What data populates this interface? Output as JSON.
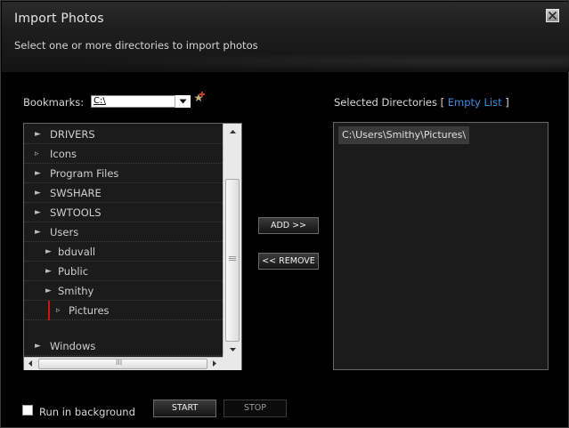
{
  "window": {
    "title": "Import Photos",
    "subtitle": "Select one or more directories to import photos",
    "close_icon": "close-x-icon"
  },
  "bookmarks": {
    "label": "Bookmarks:",
    "selected_value": "C:\\",
    "dropdown_icon": "chevron-down-icon",
    "add_icon": "add-bookmark-star-icon"
  },
  "tree": {
    "items": [
      {
        "label": "DRIVERS",
        "expanded": false
      },
      {
        "label": "Icons",
        "expanded": false,
        "leaf": true
      },
      {
        "label": "Program Files",
        "expanded": false
      },
      {
        "label": "SWSHARE",
        "expanded": false
      },
      {
        "label": "SWTOOLS",
        "expanded": false
      },
      {
        "label": "Users",
        "expanded": true
      },
      {
        "label": "bduvall",
        "expanded": false
      },
      {
        "label": "Public",
        "expanded": false
      },
      {
        "label": "Smithy",
        "expanded": true
      },
      {
        "label": "Pictures",
        "expanded": false,
        "leaf": true,
        "selected": true
      },
      {
        "label": "Windows",
        "expanded": false
      }
    ],
    "hscroll_grip": "III"
  },
  "actions": {
    "add_label": "ADD >>",
    "remove_label": "<< REMOVE"
  },
  "selected": {
    "label_prefix": "Selected Directories [",
    "link_label": "Empty List",
    "label_suffix": "]",
    "items": [
      "C:\\Users\\Smithy\\Pictures\\"
    ]
  },
  "footer": {
    "run_in_background_label": "Run in background",
    "run_in_background_checked": false,
    "start_label": "START",
    "stop_label": "STOP"
  },
  "colors": {
    "background": "#000000",
    "link": "#3e8edc",
    "selection_marker": "#c81414"
  }
}
